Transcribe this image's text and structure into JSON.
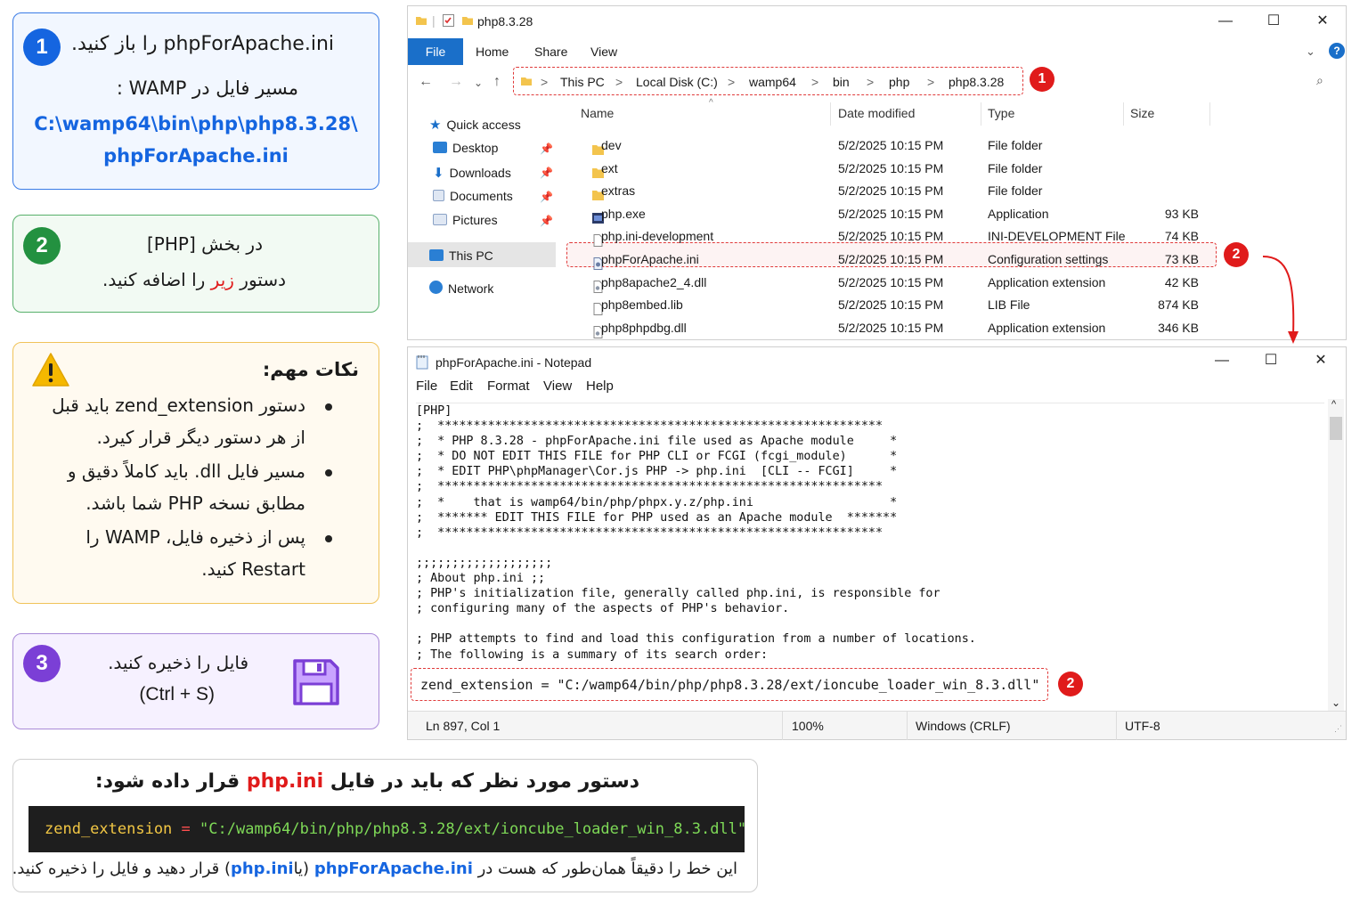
{
  "card1": {
    "badge": "1",
    "line1": "phpForApache.ini را باز کنید.",
    "line2": "مسیر فایل در WAMP :",
    "path_line1": "C:\\wamp64\\bin\\php\\php8.3.28\\",
    "path_line2": "phpForApache.ini",
    "color": "#1565e0"
  },
  "card2": {
    "badge": "2",
    "line1": "در بخش [PHP]",
    "line2_before": "دستور",
    "line2_red": "زیر",
    "line2_after": "را اضافه کنید.",
    "color": "#239140"
  },
  "notes": {
    "title": "نکات مهم:",
    "icon": "warning-icon",
    "items": [
      [
        "دستور zend_extension باید قبل",
        "از هر دستور دیگر قرار کیرد."
      ],
      [
        "مسیر فایل dll. باید کاملاً دقیق و",
        "مطابق نسخه PHP شما باشد."
      ],
      [
        "پس از ذخیره فایل، WAMP را",
        "Restart کنید."
      ]
    ]
  },
  "card3": {
    "badge": "3",
    "line1": "فایل را ذخیره کنید.",
    "line2": "(Ctrl + S)",
    "icon": "floppy-disk-icon",
    "color": "#7b3fd6"
  },
  "command_card": {
    "head_before": "دستور مورد نظر که باید در فایل",
    "head_red": "php.ini",
    "head_after": "قرار داده شود:",
    "code_key": "zend_extension",
    "code_eq": "=",
    "code_value": "\"C:/wamp64/bin/php/php8.3.28/ext/ioncube_loader_win_8.3.dll\"",
    "foot_p1": "این خط را دقیقاً همان‌طور که هست در",
    "foot_blue1": "phpForApache.ini",
    "foot_p2": "(یا",
    "foot_blue2": "php.ini",
    "foot_p3": ") قرار دهید و فایل را ذخیره کنید."
  },
  "explorer": {
    "title": "php8.3.28",
    "ribbon_tabs": [
      "File",
      "Home",
      "Share",
      "View"
    ],
    "breadcrumb": [
      "This PC",
      "Local Disk (C:)",
      "wamp64",
      "bin",
      "php",
      "php8.3.28"
    ],
    "address_badge": "1",
    "sidebar": {
      "quick_access": "Quick access",
      "pinned": [
        "Desktop",
        "Downloads",
        "Documents",
        "Pictures"
      ],
      "this_pc": "This PC",
      "network": "Network"
    },
    "columns": [
      "Name",
      "Date modified",
      "Type",
      "Size"
    ],
    "files": [
      {
        "name": "dev",
        "date": "5/2/2025 10:15 PM",
        "type": "File folder",
        "size": "",
        "icon": "folder-icon"
      },
      {
        "name": "ext",
        "date": "5/2/2025 10:15 PM",
        "type": "File folder",
        "size": "",
        "icon": "folder-icon"
      },
      {
        "name": "extras",
        "date": "5/2/2025 10:15 PM",
        "type": "File folder",
        "size": "",
        "icon": "folder-icon"
      },
      {
        "name": "php.exe",
        "date": "5/2/2025 10:15 PM",
        "type": "Application",
        "size": "93 KB",
        "icon": "exe-icon"
      },
      {
        "name": "php.ini-development",
        "date": "5/2/2025 10:15 PM",
        "type": "INI-DEVELOPMENT File",
        "size": "74 KB",
        "icon": "file-icon"
      },
      {
        "name": "phpForApache.ini",
        "date": "5/2/2025 10:15 PM",
        "type": "Configuration settings",
        "size": "73 KB",
        "icon": "ini-icon"
      },
      {
        "name": "php8apache2_4.dll",
        "date": "5/2/2025 10:15 PM",
        "type": "Application extension",
        "size": "42 KB",
        "icon": "dll-icon"
      },
      {
        "name": "php8embed.lib",
        "date": "5/2/2025 10:15 PM",
        "type": "LIB File",
        "size": "874 KB",
        "icon": "file-icon"
      },
      {
        "name": "php8phpdbg.dll",
        "date": "5/2/2025 10:15 PM",
        "type": "Application extension",
        "size": "346 KB",
        "icon": "dll-icon"
      }
    ],
    "selected_badge": "2"
  },
  "notepad": {
    "title": "phpForApache.ini - Notepad",
    "menu": [
      "File",
      "Edit",
      "Format",
      "View",
      "Help"
    ],
    "lines": [
      "[PHP]",
      ";  **************************************************************",
      ";  * PHP 8.3.28 - phpForApache.ini file used as Apache module     *",
      ";  * DO NOT EDIT THIS FILE for PHP CLI or FCGI (fcgi_module)      *",
      ";  * EDIT PHP\\phpManager\\Cor.js PHP -> php.ini  [CLI -- FCGI]     *",
      ";  **************************************************************",
      ";  *    that is wamp64/bin/php/phpx.y.z/php.ini                   *",
      ";  ******* EDIT THIS FILE for PHP used as an Apache module  *******",
      ";  **************************************************************",
      "",
      ";;;;;;;;;;;;;;;;;;;",
      "; About php.ini ;;",
      "; PHP's initialization file, generally called php.ini, is responsible for",
      "; configuring many of the aspects of PHP's behavior.",
      "",
      "; PHP attempts to find and load this configuration from a number of locations.",
      "; The following is a summary of its search order:"
    ],
    "zend_line": "zend_extension = \"C:/wamp64/bin/php/php8.3.28/ext/ioncube_loader_win_8.3.dll\"",
    "zend_badge": "2",
    "status": {
      "position": "Ln 897, Col 1",
      "zoom": "100%",
      "line_ending": "Windows (CRLF)",
      "encoding": "UTF-8"
    }
  }
}
